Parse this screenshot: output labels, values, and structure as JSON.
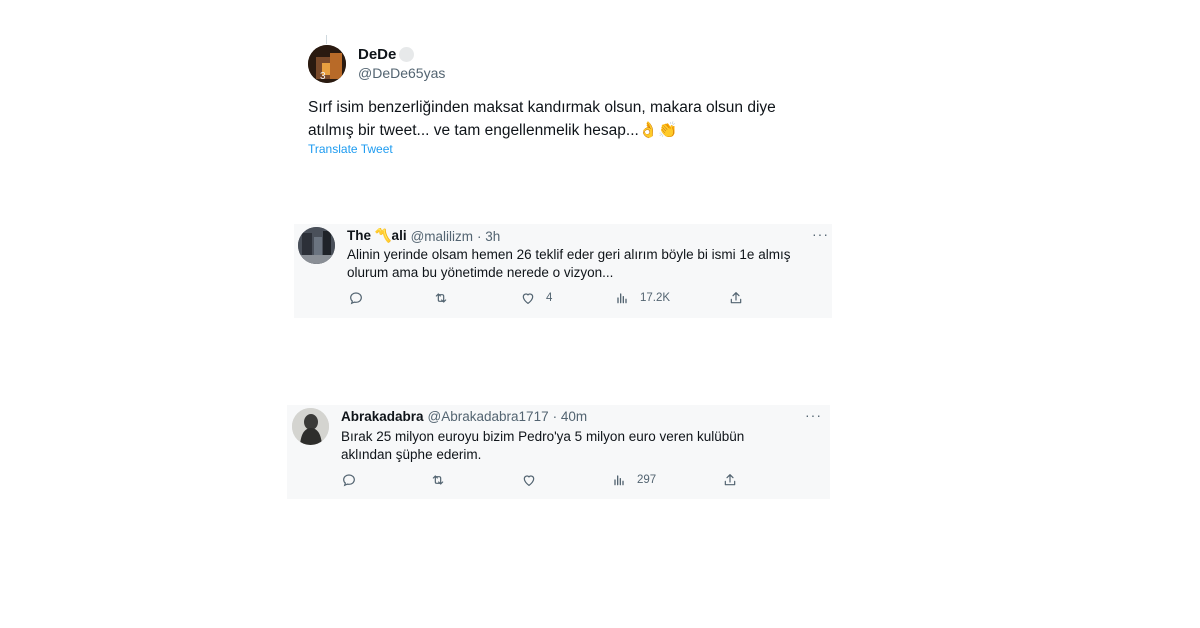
{
  "main_tweet": {
    "author_name": "DeDe",
    "handle": "@DeDe65yas",
    "text_line1": "Sırf isim benzerliğinden maksat kandırmak olsun, makara olsun diye",
    "text_line2": "atılmış bir tweet... ve tam engellenmelik hesap...👌👏",
    "translate_label": "Translate Tweet"
  },
  "replies": [
    {
      "author_name": "The 〽️ali",
      "handle": "@malilizm",
      "time": "· 3h",
      "more": "···",
      "text_line1": "Alinin yerinde olsam hemen 26 teklif eder geri alırım böyle bi ismi 1e almış",
      "text_line2": "olurum ama bu yönetimde nerede o vizyon...",
      "likes": "4",
      "views": "17.2K"
    },
    {
      "author_name": "Abrakadabra",
      "handle": "@Abrakadabra1717",
      "time": "· 40m",
      "more": "···",
      "text_line1": "Bırak 25  milyon euroyu  bizim Pedro'ya 5 milyon euro veren kulübün",
      "text_line2": "aklından şüphe ederim.",
      "likes": "",
      "views": "297"
    }
  ],
  "colors": {
    "link": "#1d9bf0",
    "secondary_text": "#536471",
    "card_background": "#f7f8f9"
  }
}
